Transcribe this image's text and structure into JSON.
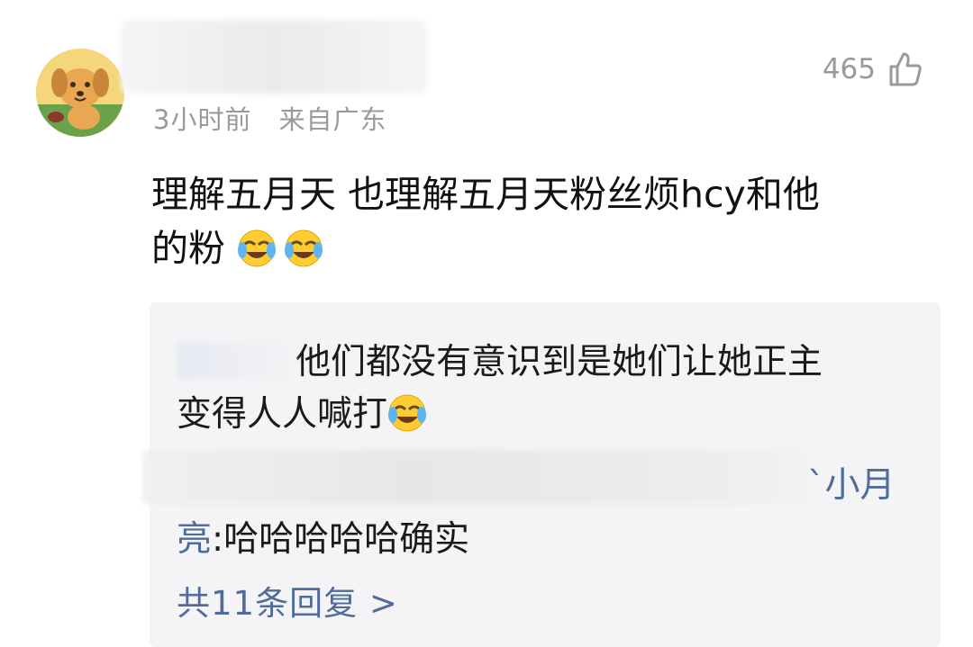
{
  "comment": {
    "meta": {
      "time": "3小时前",
      "location": "来自广东"
    },
    "likes": {
      "count": "465"
    },
    "text_line1": "理解五月天 也理解五月天粉丝烦hcy和他",
    "text_line2": "的粉",
    "emojis": [
      "laugh-cry-emoji",
      "laugh-cry-emoji"
    ]
  },
  "replies": [
    {
      "line1": "他们都没有意识到是她们让她正主",
      "line2": "变得人人喊打"
    },
    {
      "name_end": "`小月",
      "name_start_line2": "亮",
      "text": ":哈哈哈哈哈确实"
    }
  ],
  "more_replies": {
    "label": "共11条回复 >"
  },
  "colors": {
    "link": "#4f6c9b",
    "meta": "#9a9a9a",
    "reply_bg": "#f4f4f6"
  }
}
